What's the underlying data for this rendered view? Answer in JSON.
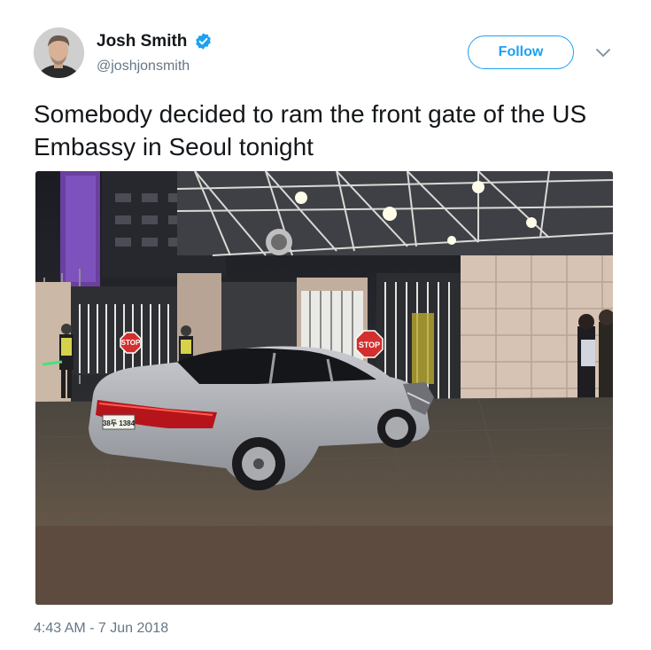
{
  "user": {
    "display_name": "Josh Smith",
    "handle": "@joshjonsmith",
    "verified": true,
    "verified_icon": "verified-badge-icon",
    "avatar_icon": "user-avatar"
  },
  "actions": {
    "follow_label": "Follow",
    "more_icon": "chevron-down-icon"
  },
  "tweet": {
    "text": "Somebody decided to ram the front gate of the US Embassy in Seoul tonight",
    "timestamp": "4:43 AM - 7 Jun 2018",
    "media": {
      "sign_left": "STOP",
      "sign_right": "STOP",
      "plate": "38두 1384"
    }
  },
  "colors": {
    "accent": "#1da1f2",
    "text": "#14171a",
    "secondary": "#657786"
  }
}
